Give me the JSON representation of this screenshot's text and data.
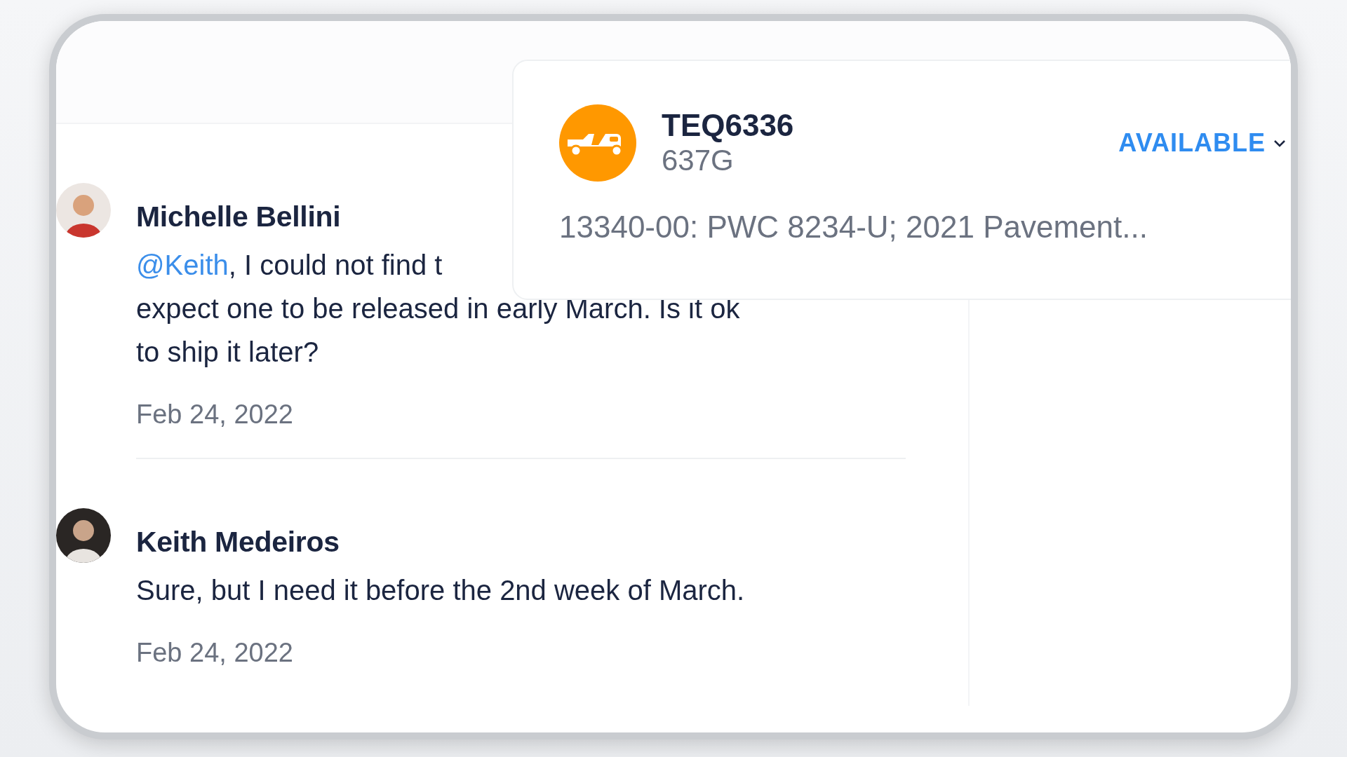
{
  "asset_card": {
    "title": "TEQ6336",
    "subtitle": "637G",
    "status": "AVAILABLE",
    "description": "13340-00: PWC 8234-U; 2021 Pavement..."
  },
  "messages": [
    {
      "author": "Michelle Bellini",
      "mention": "@Keith",
      "lines": [
        ", I could not find t",
        "expect one to be released in early March. Is it ok",
        "to ship it later?"
      ],
      "date": "Feb 24, 2022"
    },
    {
      "author": "Keith Medeiros",
      "lines": [
        "Sure, but I need it before the 2nd week of March."
      ],
      "date": "Feb 24, 2022"
    }
  ]
}
